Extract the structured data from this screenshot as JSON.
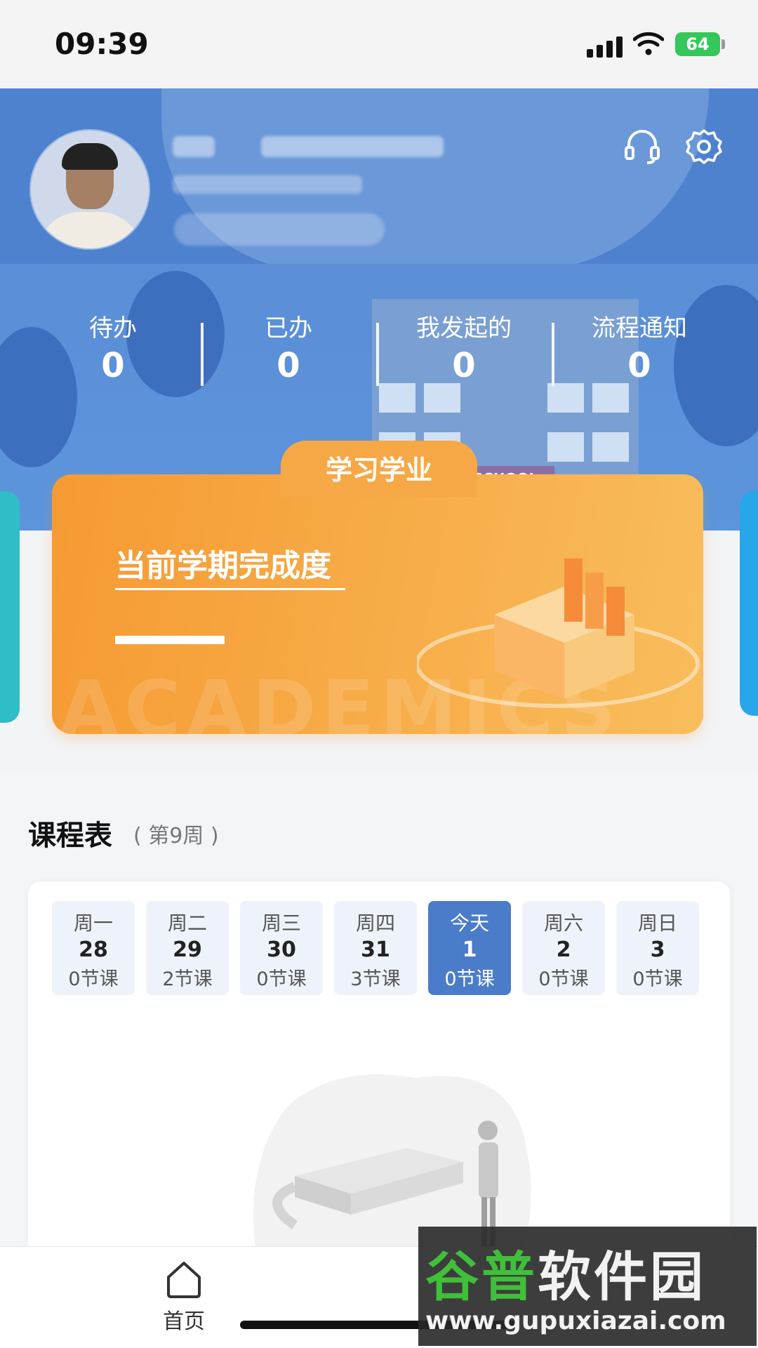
{
  "status_bar": {
    "time": "09:39",
    "battery": "64"
  },
  "stats": [
    {
      "label": "待办",
      "value": "0"
    },
    {
      "label": "已办",
      "value": "0"
    },
    {
      "label": "我发起的",
      "value": "0"
    },
    {
      "label": "流程通知",
      "value": "0"
    }
  ],
  "hero": {
    "building_sign": "SCHOOL"
  },
  "academic_card": {
    "tab_label": "学习学业",
    "title": "当前学期完成度",
    "watermark": "ACADEMICS"
  },
  "schedule": {
    "title": "课程表",
    "week": "( 第9周 )",
    "days": [
      {
        "name": "周一",
        "date": "28",
        "count": "0节课"
      },
      {
        "name": "周二",
        "date": "29",
        "count": "2节课"
      },
      {
        "name": "周三",
        "date": "30",
        "count": "0节课"
      },
      {
        "name": "周四",
        "date": "31",
        "count": "3节课"
      },
      {
        "name": "今天",
        "date": "1",
        "count": "0节课"
      },
      {
        "name": "周六",
        "date": "2",
        "count": "0节课"
      },
      {
        "name": "周日",
        "date": "3",
        "count": "0节课"
      }
    ]
  },
  "nav": {
    "home_label": "首页"
  },
  "watermark": {
    "brand_green": "谷普",
    "brand_white": "软件园",
    "url": "www.gupuxiazai.com"
  },
  "icons": [
    "headset-icon",
    "gear-icon",
    "home-icon",
    "wifi-icon",
    "signal-icon",
    "battery-icon"
  ]
}
